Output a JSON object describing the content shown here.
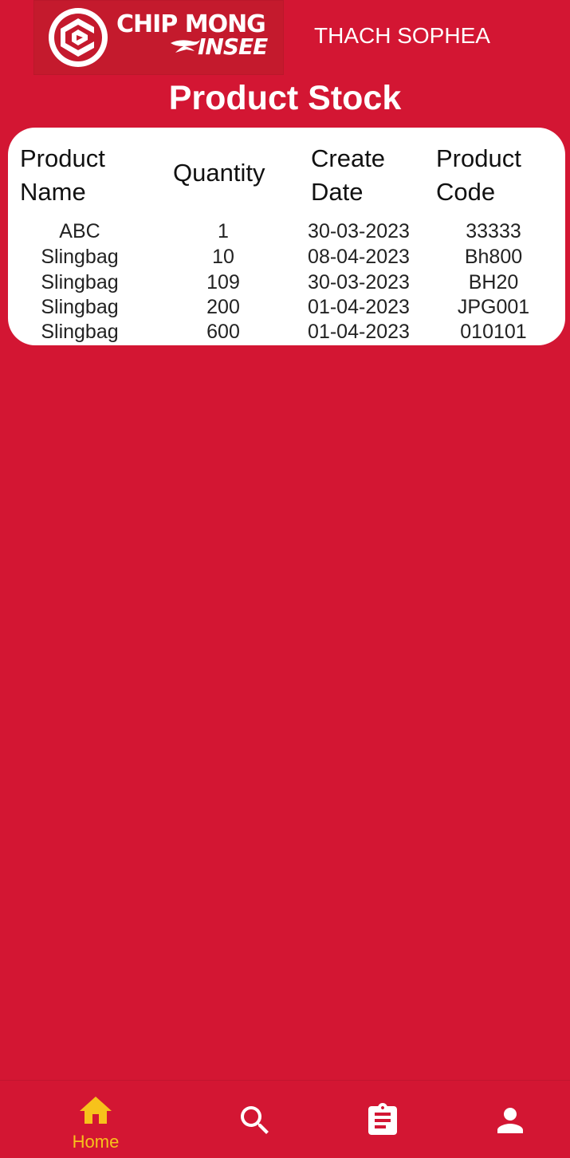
{
  "header": {
    "logo_line1": "CHIP MONG",
    "logo_line2": "INSEE",
    "user_name": "THACH SOPHEA"
  },
  "page": {
    "title": "Product Stock"
  },
  "table": {
    "columns": [
      {
        "line1": "Product",
        "line2": "Name"
      },
      {
        "line1": "Quantity",
        "line2": ""
      },
      {
        "line1": "Create",
        "line2": "Date"
      },
      {
        "line1": "Product",
        "line2": "Code"
      }
    ],
    "rows": [
      {
        "name": "ABC",
        "quantity": "1",
        "date": "30-03-2023",
        "code": "33333"
      },
      {
        "name": "Slingbag",
        "quantity": "10",
        "date": "08-04-2023",
        "code": "Bh800"
      },
      {
        "name": "Slingbag",
        "quantity": "109",
        "date": "30-03-2023",
        "code": "BH20"
      },
      {
        "name": "Slingbag",
        "quantity": "200",
        "date": "01-04-2023",
        "code": "JPG001"
      },
      {
        "name": "Slingbag",
        "quantity": "600",
        "date": "01-04-2023",
        "code": "010101"
      }
    ]
  },
  "nav": {
    "items": [
      {
        "label": "Home",
        "icon": "home-icon",
        "active": true
      },
      {
        "label": "",
        "icon": "search-icon",
        "active": false
      },
      {
        "label": "",
        "icon": "clipboard-icon",
        "active": false
      },
      {
        "label": "",
        "icon": "person-icon",
        "active": false
      }
    ],
    "active_color": "#f7c21b",
    "inactive_color": "#ffffff"
  },
  "colors": {
    "background": "#d31633",
    "logo_background": "#c41a2d",
    "card": "#ffffff"
  }
}
